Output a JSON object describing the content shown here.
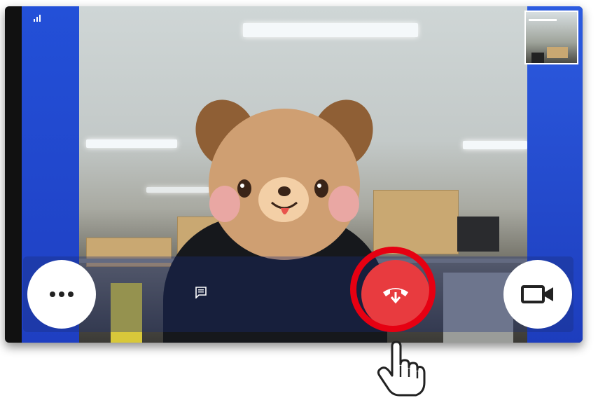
{
  "call": {
    "controls": {
      "more": {
        "icon": "more-dots-icon",
        "glyph": "•••"
      },
      "chat": {
        "icon": "chat-icon"
      },
      "hangup": {
        "icon": "hang-up-icon",
        "color": "#e83b3f"
      },
      "camera": {
        "icon": "video-camera-icon"
      }
    },
    "status": {
      "icon": "signal-bars-icon"
    },
    "self_view": {
      "icon": "self-view-thumbnail"
    },
    "overlay": {
      "icon": "dog-face-sticker"
    },
    "annotation": {
      "ring_color": "#e60012",
      "pointer": "hand-pointer-icon"
    }
  }
}
